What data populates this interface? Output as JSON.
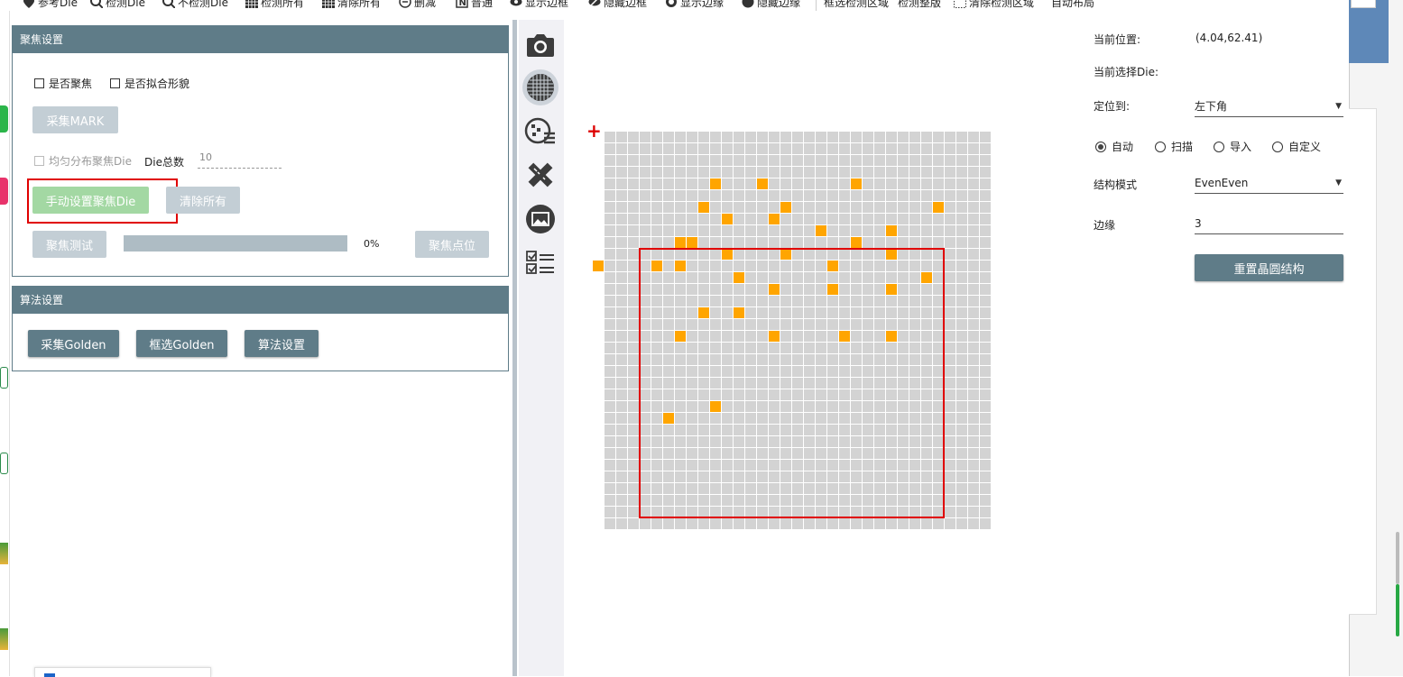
{
  "toolbar": {
    "items": [
      {
        "icon": "location-pin-icon",
        "label": "参考Die"
      },
      {
        "icon": "magnify-check-icon",
        "label": "检测Die"
      },
      {
        "icon": "magnify-cross-icon",
        "label": "不检测Die"
      },
      {
        "icon": "grid-icon",
        "label": "检测所有"
      },
      {
        "icon": "grid-clear-icon",
        "label": "清除所有"
      },
      {
        "icon": "minus-circle-icon",
        "label": "删减"
      },
      {
        "icon": "n-box-icon",
        "label": "普通"
      },
      {
        "icon": "eye-icon",
        "label": "显示边框"
      },
      {
        "icon": "eye-off-icon",
        "label": "隐藏边框"
      },
      {
        "icon": "circle-outline-icon",
        "label": "显示边缘"
      },
      {
        "icon": "circle-filled-icon",
        "label": "隐藏边缘"
      },
      {
        "icon": "",
        "label": "框选检测区域"
      },
      {
        "icon": "",
        "label": "检测整版"
      },
      {
        "icon": "dotted-grid-icon",
        "label": "清除检测区域"
      },
      {
        "icon": "",
        "label": "自动布局"
      }
    ]
  },
  "focus_panel": {
    "title": "聚焦设置",
    "checkbox_focus": "是否聚焦",
    "checkbox_fit": "是否拟合形貌",
    "collect_mark": "采集MARK",
    "checkbox_even": "均匀分布聚焦Die",
    "die_total_label": "Die总数",
    "die_total_value": "10",
    "manual_set": "手动设置聚焦Die",
    "clear_all": "清除所有",
    "focus_test": "聚焦测试",
    "progress": 0,
    "progress_text": "0%",
    "focus_point": "聚焦点位"
  },
  "algo_panel": {
    "title": "算法设置",
    "collect_golden": "采集Golden",
    "select_golden": "框选Golden",
    "algo_settings": "算法设置"
  },
  "side_icons": [
    "camera-icon",
    "wafer-grid-icon",
    "wafer-list-icon",
    "ruler-pencil-icon",
    "image-icon",
    "checklist-icon"
  ],
  "wafer": {
    "cols": 33,
    "rows": 34,
    "cell_color": "#d3d3d3",
    "selected_color": "#ffa500",
    "selected_cells": [
      [
        9,
        4
      ],
      [
        13,
        4
      ],
      [
        21,
        4
      ],
      [
        8,
        6
      ],
      [
        15,
        6
      ],
      [
        28,
        6
      ],
      [
        10,
        7
      ],
      [
        14,
        7
      ],
      [
        18,
        8
      ],
      [
        24,
        8
      ],
      [
        6,
        9
      ],
      [
        7,
        9
      ],
      [
        21,
        9
      ],
      [
        10,
        10
      ],
      [
        15,
        10
      ],
      [
        24,
        10
      ],
      [
        -1,
        11
      ],
      [
        4,
        11
      ],
      [
        6,
        11
      ],
      [
        19,
        11
      ],
      [
        11,
        12
      ],
      [
        27,
        12
      ],
      [
        14,
        13
      ],
      [
        19,
        13
      ],
      [
        24,
        13
      ],
      [
        8,
        15
      ],
      [
        11,
        15
      ],
      [
        6,
        17
      ],
      [
        14,
        17
      ],
      [
        20,
        17
      ],
      [
        24,
        17
      ],
      [
        9,
        23
      ],
      [
        5,
        24
      ]
    ],
    "detect_region": {
      "col_start": 3,
      "row_start": 10,
      "col_end": 29,
      "row_end": 33
    },
    "region_color": "#e00000"
  },
  "right_panel": {
    "current_pos_label": "当前位置:",
    "current_pos_value": "(4.04,62.41)",
    "current_die_label": "当前选择Die:",
    "locate_label": "定位到:",
    "locate_value": "左下角",
    "radios": [
      {
        "label": "自动",
        "selected": true
      },
      {
        "label": "扫描",
        "selected": false
      },
      {
        "label": "导入",
        "selected": false
      },
      {
        "label": "自定义",
        "selected": false
      }
    ],
    "struct_label": "结构模式",
    "struct_value": "EvenEven",
    "edge_label": "边缘",
    "edge_value": "3",
    "reset_button": "重置晶圆结构"
  },
  "colors": {
    "header_bg": "#5f7c88",
    "highlight_box": "#e00000"
  }
}
